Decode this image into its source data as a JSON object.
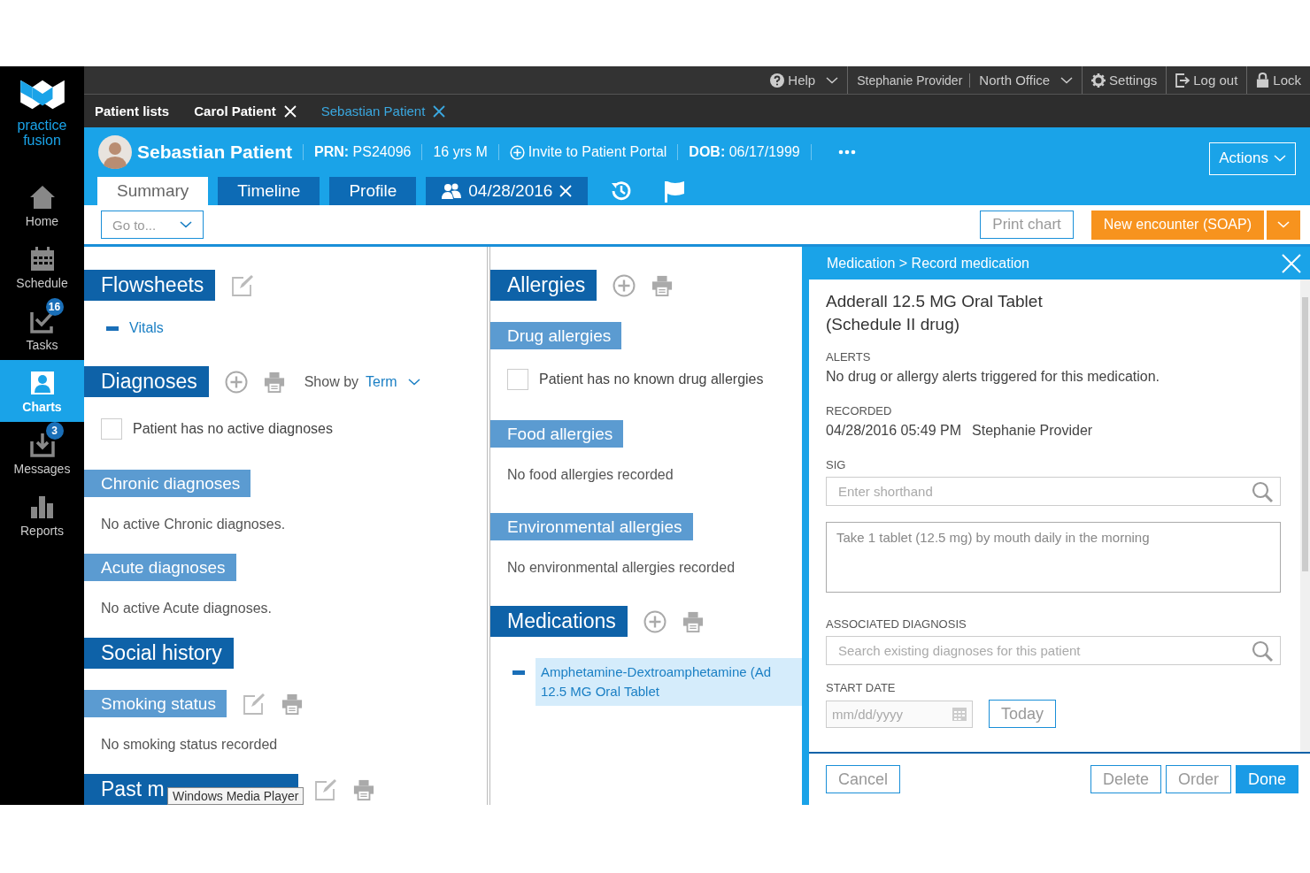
{
  "logo": {
    "line1": "practice",
    "line2": "fusion"
  },
  "nav": [
    {
      "label": "Home",
      "selected": false
    },
    {
      "label": "Schedule",
      "selected": false
    },
    {
      "label": "Tasks",
      "badge": "16",
      "selected": false
    },
    {
      "label": "Charts",
      "selected": true
    },
    {
      "label": "Messages",
      "badge": "3",
      "selected": false
    },
    {
      "label": "Reports",
      "selected": false
    }
  ],
  "topbar": {
    "help": "Help",
    "provider": "Stephanie Provider",
    "office": "North Office",
    "settings": "Settings",
    "logout": "Log out",
    "lock": "Lock"
  },
  "patient_tabs": [
    {
      "label": "Patient lists",
      "selected": false,
      "closable": false
    },
    {
      "label": "Carol Patient",
      "selected": false,
      "closable": true
    },
    {
      "label": "Sebastian Patient",
      "selected": true,
      "closable": true
    }
  ],
  "patient": {
    "name": "Sebastian Patient",
    "prn_label": "PRN:",
    "prn": "PS24096",
    "age_sex": "16 yrs M",
    "invite": "Invite to Patient Portal",
    "dob_label": "DOB:",
    "dob": "06/17/1999",
    "actions": "Actions"
  },
  "chart_tabs": [
    {
      "label": "Summary",
      "selected": true,
      "kind": "plain"
    },
    {
      "label": "Timeline",
      "selected": false,
      "kind": "plain"
    },
    {
      "label": "Profile",
      "selected": false,
      "kind": "plain"
    },
    {
      "label": "04/28/2016",
      "selected": false,
      "kind": "encounter"
    }
  ],
  "toolbar": {
    "goto": "Go to...",
    "print": "Print chart",
    "new_encounter": "New encounter (SOAP)"
  },
  "left_column": [
    {
      "kind": "major",
      "title": "Flowsheets"
    },
    {
      "kind": "link",
      "text": "Vitals"
    },
    {
      "kind": "major",
      "title": "Diagnoses",
      "show_by": "Show by",
      "term": "Term"
    },
    {
      "kind": "check",
      "text": "Patient has no active diagnoses",
      "checked": false
    },
    {
      "kind": "minor",
      "title": "Chronic diagnoses"
    },
    {
      "kind": "note",
      "text": "No active Chronic diagnoses."
    },
    {
      "kind": "minor",
      "title": "Acute diagnoses"
    },
    {
      "kind": "note",
      "text": "No active Acute diagnoses."
    },
    {
      "kind": "major",
      "title": "Social history"
    },
    {
      "kind": "minor",
      "title": "Smoking status"
    },
    {
      "kind": "note",
      "text": "No smoking status recorded"
    },
    {
      "kind": "major",
      "title": "Past m"
    }
  ],
  "middle_column": [
    {
      "kind": "major",
      "title": "Allergies"
    },
    {
      "kind": "minor",
      "title": "Drug allergies"
    },
    {
      "kind": "check",
      "text": "Patient has no known drug allergies",
      "checked": false
    },
    {
      "kind": "minor",
      "title": "Food allergies"
    },
    {
      "kind": "note",
      "text": "No food allergies recorded"
    },
    {
      "kind": "minor",
      "title": "Environmental allergies"
    },
    {
      "kind": "note",
      "text": "No environmental allergies recorded"
    },
    {
      "kind": "major",
      "title": "Medications"
    },
    {
      "kind": "med",
      "lines": [
        "Amphetamine-Dextroamphetamine (Ad",
        "12.5 MG Oral Tablet"
      ],
      "selected": true
    }
  ],
  "tooltip": "Windows Media Player",
  "panel": {
    "breadcrumb": "Medication > Record medication",
    "drug": [
      "Adderall 12.5 MG Oral Tablet",
      "(Schedule II drug)"
    ],
    "alerts_label": "ALERTS",
    "alerts": "No drug or allergy alerts triggered for this medication.",
    "recorded_label": "RECORDED",
    "recorded_at": "04/28/2016 05:49 PM",
    "recorded_by": "Stephanie Provider",
    "sig_label": "SIG",
    "sig_placeholder": "Enter shorthand",
    "sig_text": "Take 1 tablet (12.5 mg) by mouth daily in the morning",
    "diagnosis_label": "ASSOCIATED DIAGNOSIS",
    "diagnosis_placeholder": "Search existing diagnoses for this patient",
    "start_label": "START DATE",
    "start_placeholder": "mm/dd/yyyy",
    "today": "Today",
    "buttons": [
      {
        "label": "Cancel",
        "kind": "secondary"
      },
      {
        "label": "Delete",
        "kind": "secondary"
      },
      {
        "label": "Order",
        "kind": "secondary"
      },
      {
        "label": "Done",
        "kind": "primary"
      }
    ]
  }
}
